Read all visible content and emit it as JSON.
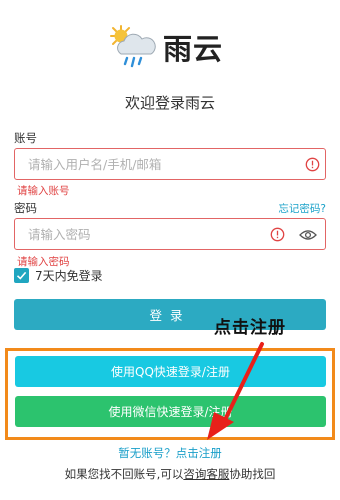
{
  "logo": {
    "text": "雨云",
    "icon": "sun-cloud-rain-icon"
  },
  "welcome": "欢迎登录雨云",
  "account": {
    "label": "账号",
    "placeholder": "请输入用户名/手机/邮箱",
    "error": "请输入账号"
  },
  "password": {
    "label": "密码",
    "placeholder": "请输入密码",
    "error": "请输入密码",
    "forgot": "忘记密码?"
  },
  "remember": {
    "label": "7天内免登录",
    "checked": true
  },
  "login_button": "登录",
  "annotation": "点击注册",
  "social": {
    "qq_label": "使用QQ快速登录/注册",
    "wechat_label": "使用微信快速登录/注册"
  },
  "register_text": "暂无账号？点击注册",
  "help": {
    "prefix": "如果您找不回账号,可以",
    "link": "咨询客服",
    "suffix": "协助找回"
  },
  "colors": {
    "accent": "#2caac2",
    "qq_button": "#18c9e2",
    "wechat_button": "#2cc36e",
    "error": "#e04444",
    "highlight": "#f28a1a",
    "arrow": "#e8201a"
  }
}
